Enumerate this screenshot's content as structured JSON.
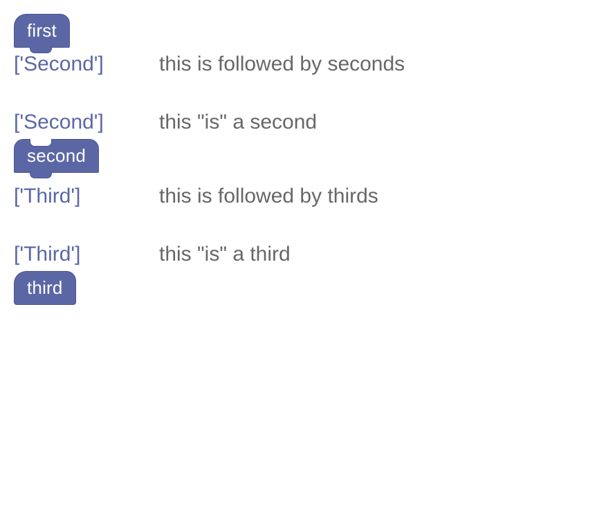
{
  "groups": [
    {
      "block": {
        "label": "first",
        "style": "hat"
      },
      "term": "['Second']",
      "desc": "this is followed by seconds"
    },
    {
      "term": "['Second']",
      "desc": "this \"is\" a second",
      "block_after": {
        "label": "second",
        "style": "mid"
      }
    },
    {
      "term": "['Third']",
      "desc": "this is followed by thirds"
    },
    {
      "term": "['Third']",
      "desc": "this \"is\" a third",
      "block_after": {
        "label": "third",
        "style": "end-hat"
      }
    }
  ],
  "colors": {
    "block_fill": "#5B67A5",
    "block_border": "#4a5590",
    "term_text": "#5B67A5",
    "desc_text": "#676767"
  }
}
